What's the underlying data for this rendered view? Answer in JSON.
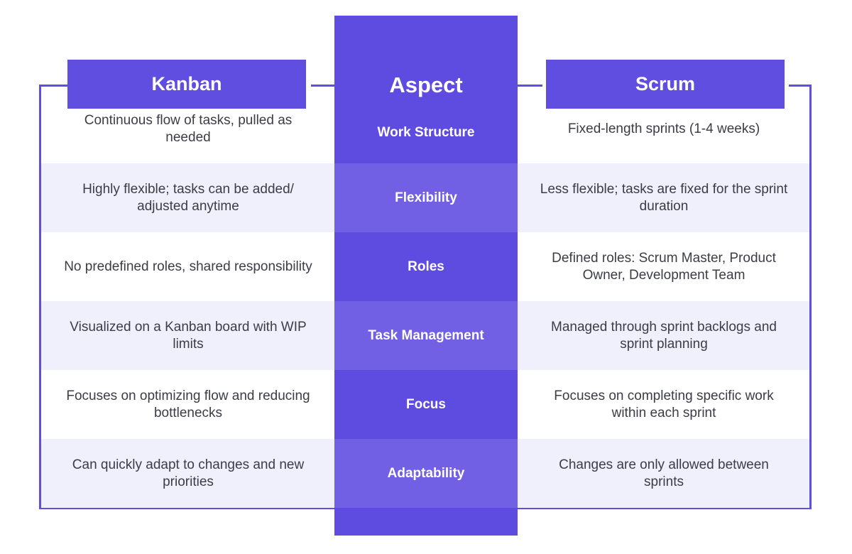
{
  "headers": {
    "left": "Kanban",
    "center": "Aspect",
    "right": "Scrum"
  },
  "colors": {
    "accent": "#5f4ee0",
    "accent_light": "#7160e4",
    "row_alt_bg": "#eff0fc",
    "text": "#3c3c46"
  },
  "rows": [
    {
      "aspect": "Work Structure",
      "kanban": "Continuous flow of tasks, pulled as needed",
      "scrum": "Fixed-length sprints (1-4 weeks)"
    },
    {
      "aspect": "Flexibility",
      "kanban": "Highly flexible; tasks can be added/ adjusted anytime",
      "scrum": "Less flexible; tasks are fixed for the sprint duration"
    },
    {
      "aspect": "Roles",
      "kanban": "No predefined roles, shared responsibility",
      "scrum": "Defined roles: Scrum Master, Product Owner, Development Team"
    },
    {
      "aspect": "Task Management",
      "kanban": "Visualized on a Kanban board with WIP limits",
      "scrum": "Managed through sprint backlogs and sprint planning"
    },
    {
      "aspect": "Focus",
      "kanban": "Focuses on optimizing flow and reducing bottlenecks",
      "scrum": "Focuses on completing specific work within each sprint"
    },
    {
      "aspect": "Adaptability",
      "kanban": "Can quickly adapt to changes and new priorities",
      "scrum": "Changes are only allowed between sprints"
    }
  ]
}
